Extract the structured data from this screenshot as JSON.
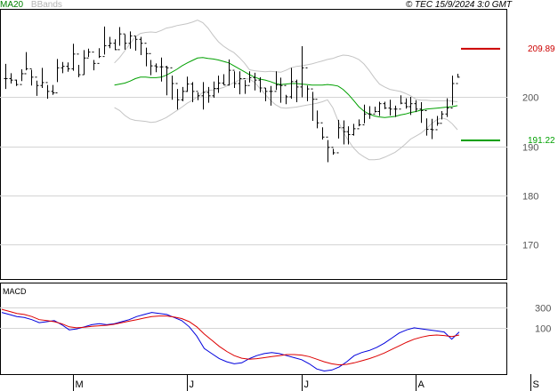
{
  "header": {
    "legend_ma": "MA20",
    "legend_bb": "BBands",
    "copyright": "© TEC 15/9/2024 3:0 GMT"
  },
  "chart_data": [
    {
      "type": "ohlc",
      "indicators": [
        "MA20",
        "BBands"
      ],
      "x_month_labels": [
        "M",
        "J",
        "J",
        "A",
        "S"
      ],
      "y_ticks": [
        170,
        180,
        190,
        200
      ],
      "y_tick_labels": [
        "170",
        "180",
        "190",
        "200"
      ],
      "ylim": [
        163,
        218
      ],
      "grid": true,
      "resistance": {
        "value": 209.89,
        "label": "209.89",
        "color": "#cc0000"
      },
      "support": {
        "value": 191.22,
        "label": "191.22",
        "color": "#00a000"
      },
      "close": [
        203.8,
        203.5,
        202.6,
        204.8,
        205.8,
        204.1,
        202.4,
        203.0,
        201.2,
        200.9,
        206.0,
        206.3,
        205.8,
        208.8,
        204.6,
        208.0,
        209.2,
        206.9,
        208.3,
        210.5,
        211.0,
        209.7,
        212.9,
        211.0,
        212.5,
        211.8,
        211.0,
        208.9,
        206.4,
        206.2,
        206.2,
        206.0,
        202.8,
        199.5,
        201.2,
        202.7,
        201.2,
        200.3,
        201.0,
        200.3,
        201.8,
        202.9,
        202.5,
        205.5,
        202.8,
        203.8,
        202.4,
        204.0,
        203.5,
        201.9,
        201.2,
        201.2,
        202.5,
        202.4,
        200.1,
        203.2,
        202.1,
        206.0,
        201.7,
        199.6,
        194.8,
        191.9,
        189.8,
        188.7,
        193.8,
        193.0,
        192.4,
        193.6,
        194.4,
        196.6,
        196.6,
        197.1,
        198.7,
        197.8,
        197.6,
        197.6,
        198.8,
        198.1,
        198.7,
        197.6,
        197.3,
        193.5,
        193.4,
        194.7,
        196.6,
        197.8,
        202.8,
        204.1
      ],
      "high": [
        206.8,
        204.9,
        203.6,
        205.7,
        209.2,
        205.6,
        203.4,
        206.0,
        202.5,
        202.5,
        207.8,
        207.2,
        207.1,
        210.9,
        206.6,
        209.6,
        209.9,
        207.6,
        210.0,
        214.4,
        212.3,
        211.8,
        214.3,
        212.8,
        213.4,
        212.4,
        212.3,
        210.1,
        207.6,
        206.9,
        208.1,
        206.4,
        204.4,
        201.7,
        202.1,
        204.2,
        203.1,
        201.0,
        203.1,
        202.1,
        203.2,
        204.4,
        204.7,
        207.7,
        205.3,
        205.3,
        203.5,
        205.3,
        205.0,
        204.1,
        201.9,
        202.3,
        205.3,
        204.0,
        200.5,
        206.0,
        203.6,
        210.4,
        202.4,
        201.1,
        197.3,
        193.9,
        191.3,
        189.5,
        195.4,
        195.3,
        194.1,
        194.6,
        195.5,
        198.5,
        198.2,
        198.1,
        199.1,
        199.1,
        199.5,
        198.3,
        200.4,
        199.8,
        200.1,
        199.4,
        199.0,
        195.7,
        195.6,
        196.2,
        197.2,
        199.8,
        204.4,
        204.8
      ],
      "low": [
        201.7,
        202.8,
        202.3,
        203.3,
        205.5,
        202.4,
        200.3,
        201.9,
        199.7,
        200.5,
        203.1,
        204.9,
        205.2,
        205.4,
        204.1,
        204.6,
        208.2,
        205.5,
        208.0,
        208.7,
        210.0,
        209.6,
        210.5,
        209.7,
        209.9,
        209.5,
        208.6,
        206.3,
        204.5,
        205.1,
        203.2,
        200.4,
        199.5,
        197.5,
        199.2,
        201.1,
        199.0,
        199.4,
        197.5,
        198.9,
        199.9,
        200.9,
        202.5,
        202.4,
        201.9,
        200.6,
        200.7,
        203.0,
        201.4,
        201.0,
        199.2,
        198.3,
        201.5,
        198.9,
        198.6,
        199.7,
        199.0,
        200.0,
        199.2,
        195.2,
        193.7,
        191.4,
        186.8,
        188.3,
        191.6,
        190.4,
        190.4,
        192.2,
        194.1,
        194.7,
        195.6,
        196.9,
        196.2,
        197.6,
        196.3,
        196.0,
        198.6,
        197.7,
        196.4,
        197.0,
        194.8,
        192.2,
        191.5,
        194.2,
        195.5,
        196.0,
        198.4,
        204.0
      ],
      "ma20": [
        202.5,
        202.7,
        202.9,
        203.3,
        203.8,
        204.1,
        204.1,
        204.0,
        204.0,
        204.1,
        204.5,
        205.1,
        205.7,
        206.4,
        207.0,
        207.5,
        208.0,
        208.1,
        207.9,
        207.8,
        207.6,
        207.3,
        207.0,
        206.4,
        205.8,
        205.2,
        204.6,
        204.1,
        203.7,
        203.5,
        203.2,
        202.8,
        202.6,
        202.7,
        202.8,
        202.8,
        202.7,
        202.6,
        202.5,
        202.5,
        202.5,
        202.6,
        202.5,
        202.3,
        201.6,
        200.6,
        199.4,
        198.1,
        197.2,
        196.6,
        196.2,
        196.0,
        195.9,
        196.0,
        196.1,
        196.4,
        196.6,
        196.9,
        197.1,
        197.4,
        197.6,
        197.7,
        197.8,
        197.9,
        198.0,
        198.1,
        198.3
      ],
      "bb_upper": [
        207.0,
        208.1,
        209.5,
        210.9,
        212.3,
        213.0,
        213.2,
        213.3,
        213.2,
        213.6,
        214.1,
        214.3,
        214.6,
        214.8,
        215.0,
        215.3,
        215.7,
        215.2,
        214.1,
        212.6,
        211.3,
        210.4,
        209.7,
        209.1,
        208.1,
        207.0,
        205.6,
        205.4,
        205.3,
        205.2,
        205.3,
        205.2,
        205.1,
        205.5,
        206.0,
        206.3,
        206.4,
        206.6,
        206.8,
        207.1,
        207.4,
        207.7,
        207.9,
        208.3,
        208.6,
        208.5,
        208.2,
        207.7,
        206.8,
        205.5,
        204.0,
        202.7,
        202.1,
        201.6,
        201.4,
        201.2,
        200.8,
        200.3,
        199.6,
        199.4,
        199.4,
        199.3,
        199.3,
        199.3,
        199.3,
        199.2,
        199.1
      ],
      "bb_lower": [
        197.9,
        197.3,
        196.3,
        195.6,
        195.3,
        195.2,
        195.1,
        194.9,
        195.0,
        195.4,
        195.9,
        196.6,
        197.3,
        198.0,
        198.8,
        199.4,
        200.1,
        201.0,
        201.4,
        201.5,
        201.7,
        202.0,
        202.5,
        203.0,
        203.5,
        203.8,
        203.7,
        203.0,
        201.8,
        200.6,
        199.4,
        198.5,
        197.9,
        197.8,
        197.9,
        198.0,
        198.2,
        198.4,
        198.6,
        198.8,
        199.1,
        199.5,
        197.9,
        195.3,
        193.0,
        191.2,
        189.7,
        188.6,
        187.9,
        187.3,
        187.3,
        187.4,
        187.8,
        188.3,
        188.8,
        189.6,
        190.5,
        191.5,
        192.1,
        192.7,
        193.6,
        194.6,
        195.4,
        195.8,
        195.5,
        194.6,
        193.4
      ]
    },
    {
      "type": "line",
      "title": "MACD",
      "y_ticks": [
        100,
        300
      ],
      "y_tick_labels": [
        "100",
        "300"
      ],
      "ylim": [
        -350,
        540
      ],
      "series": [
        {
          "color": "#0000dd",
          "values": [
            250,
            230,
            210,
            200,
            180,
            150,
            160,
            170,
            130,
            80,
            90,
            110,
            130,
            140,
            130,
            140,
            160,
            180,
            210,
            230,
            250,
            240,
            230,
            200,
            170,
            110,
            20,
            -100,
            -150,
            -200,
            -230,
            -250,
            -240,
            -200,
            -170,
            -150,
            -140,
            -150,
            -170,
            -190,
            -210,
            -250,
            -300,
            -320,
            -310,
            -280,
            -230,
            -170,
            -140,
            -120,
            -90,
            -50,
            0,
            50,
            80,
            100,
            90,
            80,
            70,
            60,
            -10,
            60
          ]
        },
        {
          "color": "#dd0000",
          "values": [
            280,
            260,
            240,
            230,
            210,
            180,
            170,
            160,
            140,
            110,
            100,
            105,
            115,
            120,
            125,
            135,
            150,
            165,
            180,
            195,
            210,
            215,
            215,
            205,
            190,
            160,
            110,
            40,
            -20,
            -80,
            -130,
            -170,
            -195,
            -205,
            -200,
            -190,
            -180,
            -170,
            -160,
            -160,
            -165,
            -180,
            -205,
            -230,
            -250,
            -260,
            -255,
            -240,
            -220,
            -200,
            -175,
            -145,
            -110,
            -75,
            -40,
            -10,
            10,
            25,
            30,
            25,
            15,
            30
          ]
        }
      ]
    }
  ]
}
